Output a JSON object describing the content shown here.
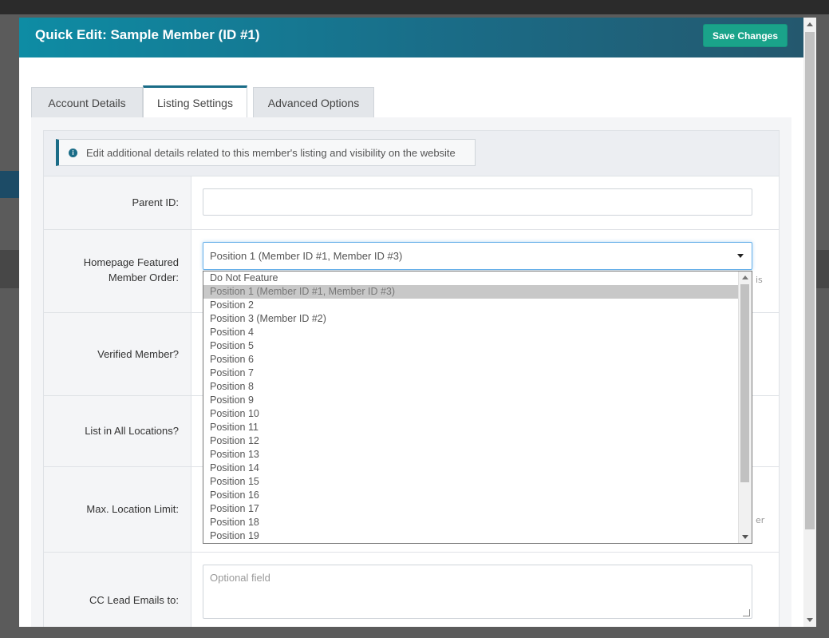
{
  "modal": {
    "title": "Quick Edit: Sample Member (ID #1)",
    "save_label": "Save Changes"
  },
  "tabs": [
    {
      "label": "Account Details",
      "active": false
    },
    {
      "label": "Listing Settings",
      "active": true
    },
    {
      "label": "Advanced Options",
      "active": false
    }
  ],
  "info": {
    "text": "Edit additional details related to this member's listing and visibility on the website"
  },
  "fields": {
    "parent_id": {
      "label": "Parent ID:",
      "value": ""
    },
    "featured_order": {
      "label": "Homepage Featured Member Order:",
      "value": "Position 1 (Member ID #1, Member ID #3)"
    },
    "verified": {
      "label": "Verified Member?"
    },
    "all_locations": {
      "label": "List in All Locations?"
    },
    "max_location": {
      "label": "Max. Location Limit:"
    },
    "cc_emails": {
      "label": "CC Lead Emails to:",
      "placeholder": "Optional field"
    }
  },
  "dropdown": {
    "selected_index": 1,
    "options": [
      "Do Not Feature",
      "Position 1 (Member ID #1, Member ID #3)",
      "Position 2",
      "Position 3 (Member ID #2)",
      "Position 4",
      "Position 5",
      "Position 6",
      "Position 7",
      "Position 8",
      "Position 9",
      "Position 10",
      "Position 11",
      "Position 12",
      "Position 13",
      "Position 14",
      "Position 15",
      "Position 16",
      "Position 17",
      "Position 18",
      "Position 19"
    ]
  },
  "fragments": {
    "is": "is",
    "er": "er"
  }
}
